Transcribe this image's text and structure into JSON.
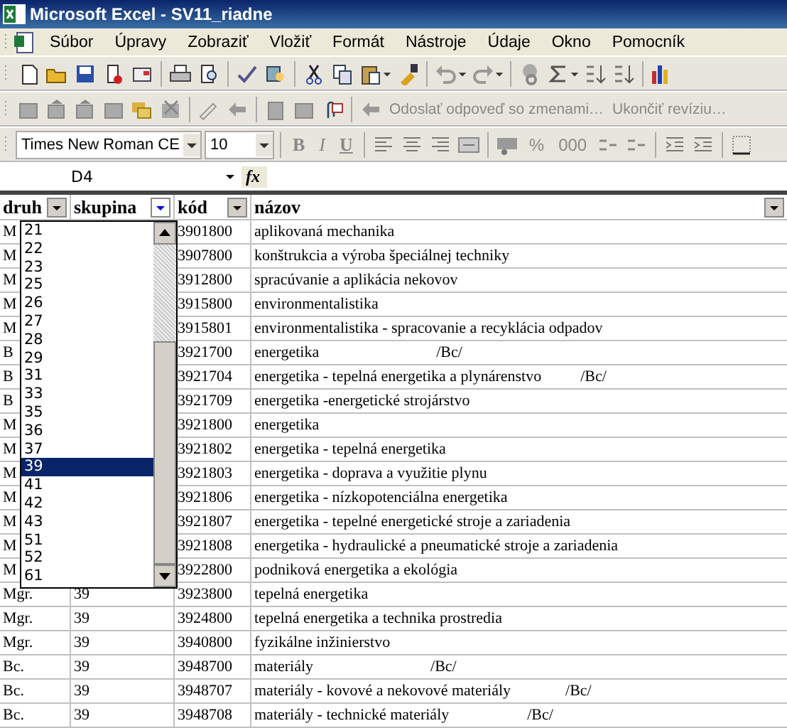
{
  "window": {
    "title": "Microsoft Excel - SV11_riadne"
  },
  "menu": [
    "Súbor",
    "Úpravy",
    "Zobraziť",
    "Vložiť",
    "Formát",
    "Nástroje",
    "Údaje",
    "Okno",
    "Pomocník"
  ],
  "review_toolbar": {
    "buttons": [
      "Odoslať odpoveď so zmenami…",
      "Ukončiť revíziu…"
    ]
  },
  "format_toolbar": {
    "font": "Times New Roman CE",
    "size": "10",
    "style_buttons": [
      "B",
      "I",
      "U"
    ],
    "number_buttons": [
      "%",
      "000"
    ]
  },
  "formula_bar": {
    "name_box": "D4",
    "fx": "fx"
  },
  "columns": [
    {
      "label": "druh",
      "filter_active": false
    },
    {
      "label": "skupina",
      "filter_active": true
    },
    {
      "label": "kód",
      "filter_active": false
    },
    {
      "label": "názov",
      "filter_active": false
    }
  ],
  "rows": [
    {
      "druh": "M",
      "skupina": "",
      "kod": "3901800",
      "nazov": "aplikovaná mechanika"
    },
    {
      "druh": "M",
      "skupina": "",
      "kod": "3907800",
      "nazov": "konštrukcia a výroba špeciálnej techniky"
    },
    {
      "druh": "M",
      "skupina": "",
      "kod": "3912800",
      "nazov": "spracúvanie a aplikácia nekovov"
    },
    {
      "druh": "M",
      "skupina": "",
      "kod": "3915800",
      "nazov": "environmentalistika"
    },
    {
      "druh": "M",
      "skupina": "",
      "kod": "3915801",
      "nazov": "environmentalistika - spracovanie a recyklácia odpadov"
    },
    {
      "druh": "B",
      "skupina": "",
      "kod": "3921700",
      "nazov": "energetika                              /Bc/"
    },
    {
      "druh": "B",
      "skupina": "",
      "kod": "3921704",
      "nazov": "energetika - tepelná energetika a plynárenstvo          /Bc/"
    },
    {
      "druh": "B",
      "skupina": "",
      "kod": "3921709",
      "nazov": "energetika -energetické strojárstvo"
    },
    {
      "druh": "M",
      "skupina": "",
      "kod": "3921800",
      "nazov": "energetika"
    },
    {
      "druh": "M",
      "skupina": "",
      "kod": "3921802",
      "nazov": "energetika - tepelná energetika"
    },
    {
      "druh": "M",
      "skupina": "",
      "kod": "3921803",
      "nazov": "energetika - doprava a využitie plynu"
    },
    {
      "druh": "M",
      "skupina": "",
      "kod": "3921806",
      "nazov": "energetika - nízkopotenciálna energetika"
    },
    {
      "druh": "M",
      "skupina": "",
      "kod": "3921807",
      "nazov": "energetika - tepelné energetické stroje a zariadenia"
    },
    {
      "druh": "M",
      "skupina": "",
      "kod": "3921808",
      "nazov": "energetika - hydraulické a pneumatické stroje a zariadenia"
    },
    {
      "druh": "M",
      "skupina": "",
      "kod": "3922800",
      "nazov": "podniková energetika a ekológia"
    },
    {
      "druh": "Mgr.",
      "skupina": "39",
      "kod": "3923800",
      "nazov": "tepelná energetika"
    },
    {
      "druh": "Mgr.",
      "skupina": "39",
      "kod": "3924800",
      "nazov": "tepelná energetika a technika prostredia"
    },
    {
      "druh": "Mgr.",
      "skupina": "39",
      "kod": "3940800",
      "nazov": "fyzikálne inžinierstvo"
    },
    {
      "druh": "Bc.",
      "skupina": "39",
      "kod": "3948700",
      "nazov": "materiály                              /Bc/"
    },
    {
      "druh": "Bc.",
      "skupina": "39",
      "kod": "3948707",
      "nazov": "materiály - kovové a nekovové materiály              /Bc/"
    },
    {
      "druh": "Bc.",
      "skupina": "39",
      "kod": "3948708",
      "nazov": "materiály - technické materiály                    /Bc/"
    }
  ],
  "filter_list": [
    {
      "label": "21",
      "selected": false
    },
    {
      "label": "22",
      "selected": false
    },
    {
      "label": "23",
      "selected": false
    },
    {
      "label": "25",
      "selected": false
    },
    {
      "label": "26",
      "selected": false
    },
    {
      "label": "27",
      "selected": false
    },
    {
      "label": "28",
      "selected": false
    },
    {
      "label": "29",
      "selected": false
    },
    {
      "label": "31",
      "selected": false
    },
    {
      "label": "33",
      "selected": false
    },
    {
      "label": "35",
      "selected": false
    },
    {
      "label": "36",
      "selected": false
    },
    {
      "label": "37",
      "selected": false
    },
    {
      "label": "39",
      "selected": true
    },
    {
      "label": "41",
      "selected": false
    },
    {
      "label": "42",
      "selected": false
    },
    {
      "label": "43",
      "selected": false
    },
    {
      "label": "51",
      "selected": false
    },
    {
      "label": "52",
      "selected": false
    },
    {
      "label": "61",
      "selected": false
    }
  ]
}
